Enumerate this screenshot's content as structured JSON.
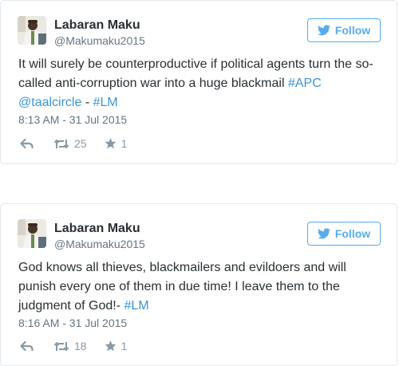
{
  "tweets": [
    {
      "name": "Labaran Maku",
      "handle": "@Makumaku2015",
      "follow_label": "Follow",
      "text_plain": "It will surely be counterproductive if political agents turn the so-called anti-corruption war into a huge blackmail",
      "tags": [
        "#APC",
        "@taalcircle",
        "#LM"
      ],
      "sep": "-",
      "timestamp": "8:13 AM - 31 Jul 2015",
      "retweets": "25",
      "likes": "1"
    },
    {
      "name": "Labaran Maku",
      "handle": "@Makumaku2015",
      "follow_label": "Follow",
      "text_plain": "God knows all thieves, blackmailers and evildoers and will punish every one of them in due time! I leave them to the judgment of God!-",
      "tags": [
        "#LM"
      ],
      "timestamp": "8:16 AM - 31 Jul 2015",
      "retweets": "18",
      "likes": "1"
    }
  ],
  "colors": {
    "accent": "#55acee",
    "link": "#3b94d9",
    "muted": "#66757f",
    "icon": "#8899a6",
    "border": "#e1e8ed"
  },
  "icons": {
    "follow": "bird-icon",
    "reply": "reply-icon",
    "retweet": "retweet-icon",
    "like": "star-icon"
  }
}
